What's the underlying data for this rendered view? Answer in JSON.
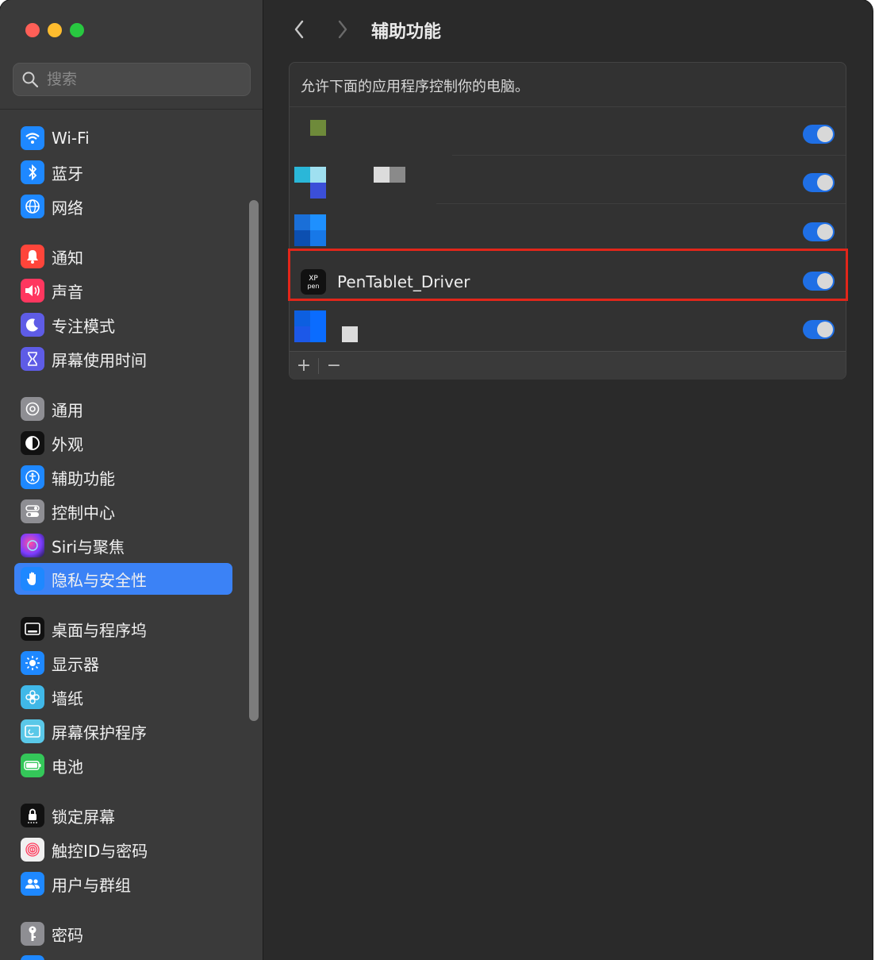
{
  "search": {
    "placeholder": "搜索"
  },
  "sidebar": {
    "items": [
      {
        "label": "Wi-Fi",
        "color": "#1e88ff",
        "icon": "wifi-icon"
      },
      {
        "label": "蓝牙",
        "color": "#1e88ff",
        "icon": "bluetooth-icon"
      },
      {
        "label": "网络",
        "color": "#1e88ff",
        "icon": "globe-icon"
      },
      {
        "label": "通知",
        "color": "#ff453a",
        "icon": "bell-icon"
      },
      {
        "label": "声音",
        "color": "#ff375f",
        "icon": "speaker-icon"
      },
      {
        "label": "专注模式",
        "color": "#5e5ce6",
        "icon": "moon-icon"
      },
      {
        "label": "屏幕使用时间",
        "color": "#5e5ce6",
        "icon": "hourglass-icon"
      },
      {
        "label": "通用",
        "color": "#8e8e93",
        "icon": "gear-icon"
      },
      {
        "label": "外观",
        "color": "#111111",
        "icon": "appearance-icon"
      },
      {
        "label": "辅助功能",
        "color": "#1e88ff",
        "icon": "accessibility-icon"
      },
      {
        "label": "控制中心",
        "color": "#8e8e93",
        "icon": "control-center-icon"
      },
      {
        "label": "Siri与聚焦",
        "color": "#7a3cff",
        "icon": "siri-icon"
      },
      {
        "label": "隐私与安全性",
        "color": "#1e88ff",
        "icon": "hand-icon",
        "active": true
      },
      {
        "label": "桌面与程序坞",
        "color": "#111111",
        "icon": "dock-icon"
      },
      {
        "label": "显示器",
        "color": "#1e88ff",
        "icon": "sun-icon"
      },
      {
        "label": "墙纸",
        "color": "#40b8e8",
        "icon": "flower-icon"
      },
      {
        "label": "屏幕保护程序",
        "color": "#5ac8e8",
        "icon": "screensaver-icon"
      },
      {
        "label": "电池",
        "color": "#34c759",
        "icon": "battery-icon"
      },
      {
        "label": "锁定屏幕",
        "color": "#111111",
        "icon": "lock-icon"
      },
      {
        "label": "触控ID与密码",
        "color": "#f0f0f0",
        "icon": "fingerprint-icon"
      },
      {
        "label": "用户与群组",
        "color": "#1e88ff",
        "icon": "users-icon"
      },
      {
        "label": "密码",
        "color": "#8e8e93",
        "icon": "key-icon"
      }
    ]
  },
  "header": {
    "title": "辅助功能"
  },
  "panel": {
    "description": "允许下面的应用程序控制你的电脑。",
    "apps": [
      {
        "name": "",
        "enabled": true
      },
      {
        "name": "",
        "enabled": true
      },
      {
        "name": "",
        "enabled": true
      },
      {
        "name": "PenTablet_Driver",
        "enabled": true,
        "highlighted": true
      },
      {
        "name": "",
        "enabled": true
      }
    ],
    "add_label": "+",
    "remove_label": "−"
  },
  "colors": {
    "accent": "#3b82f6",
    "toggle_on": "#1f6fe5",
    "highlight_box": "#e2261a"
  }
}
